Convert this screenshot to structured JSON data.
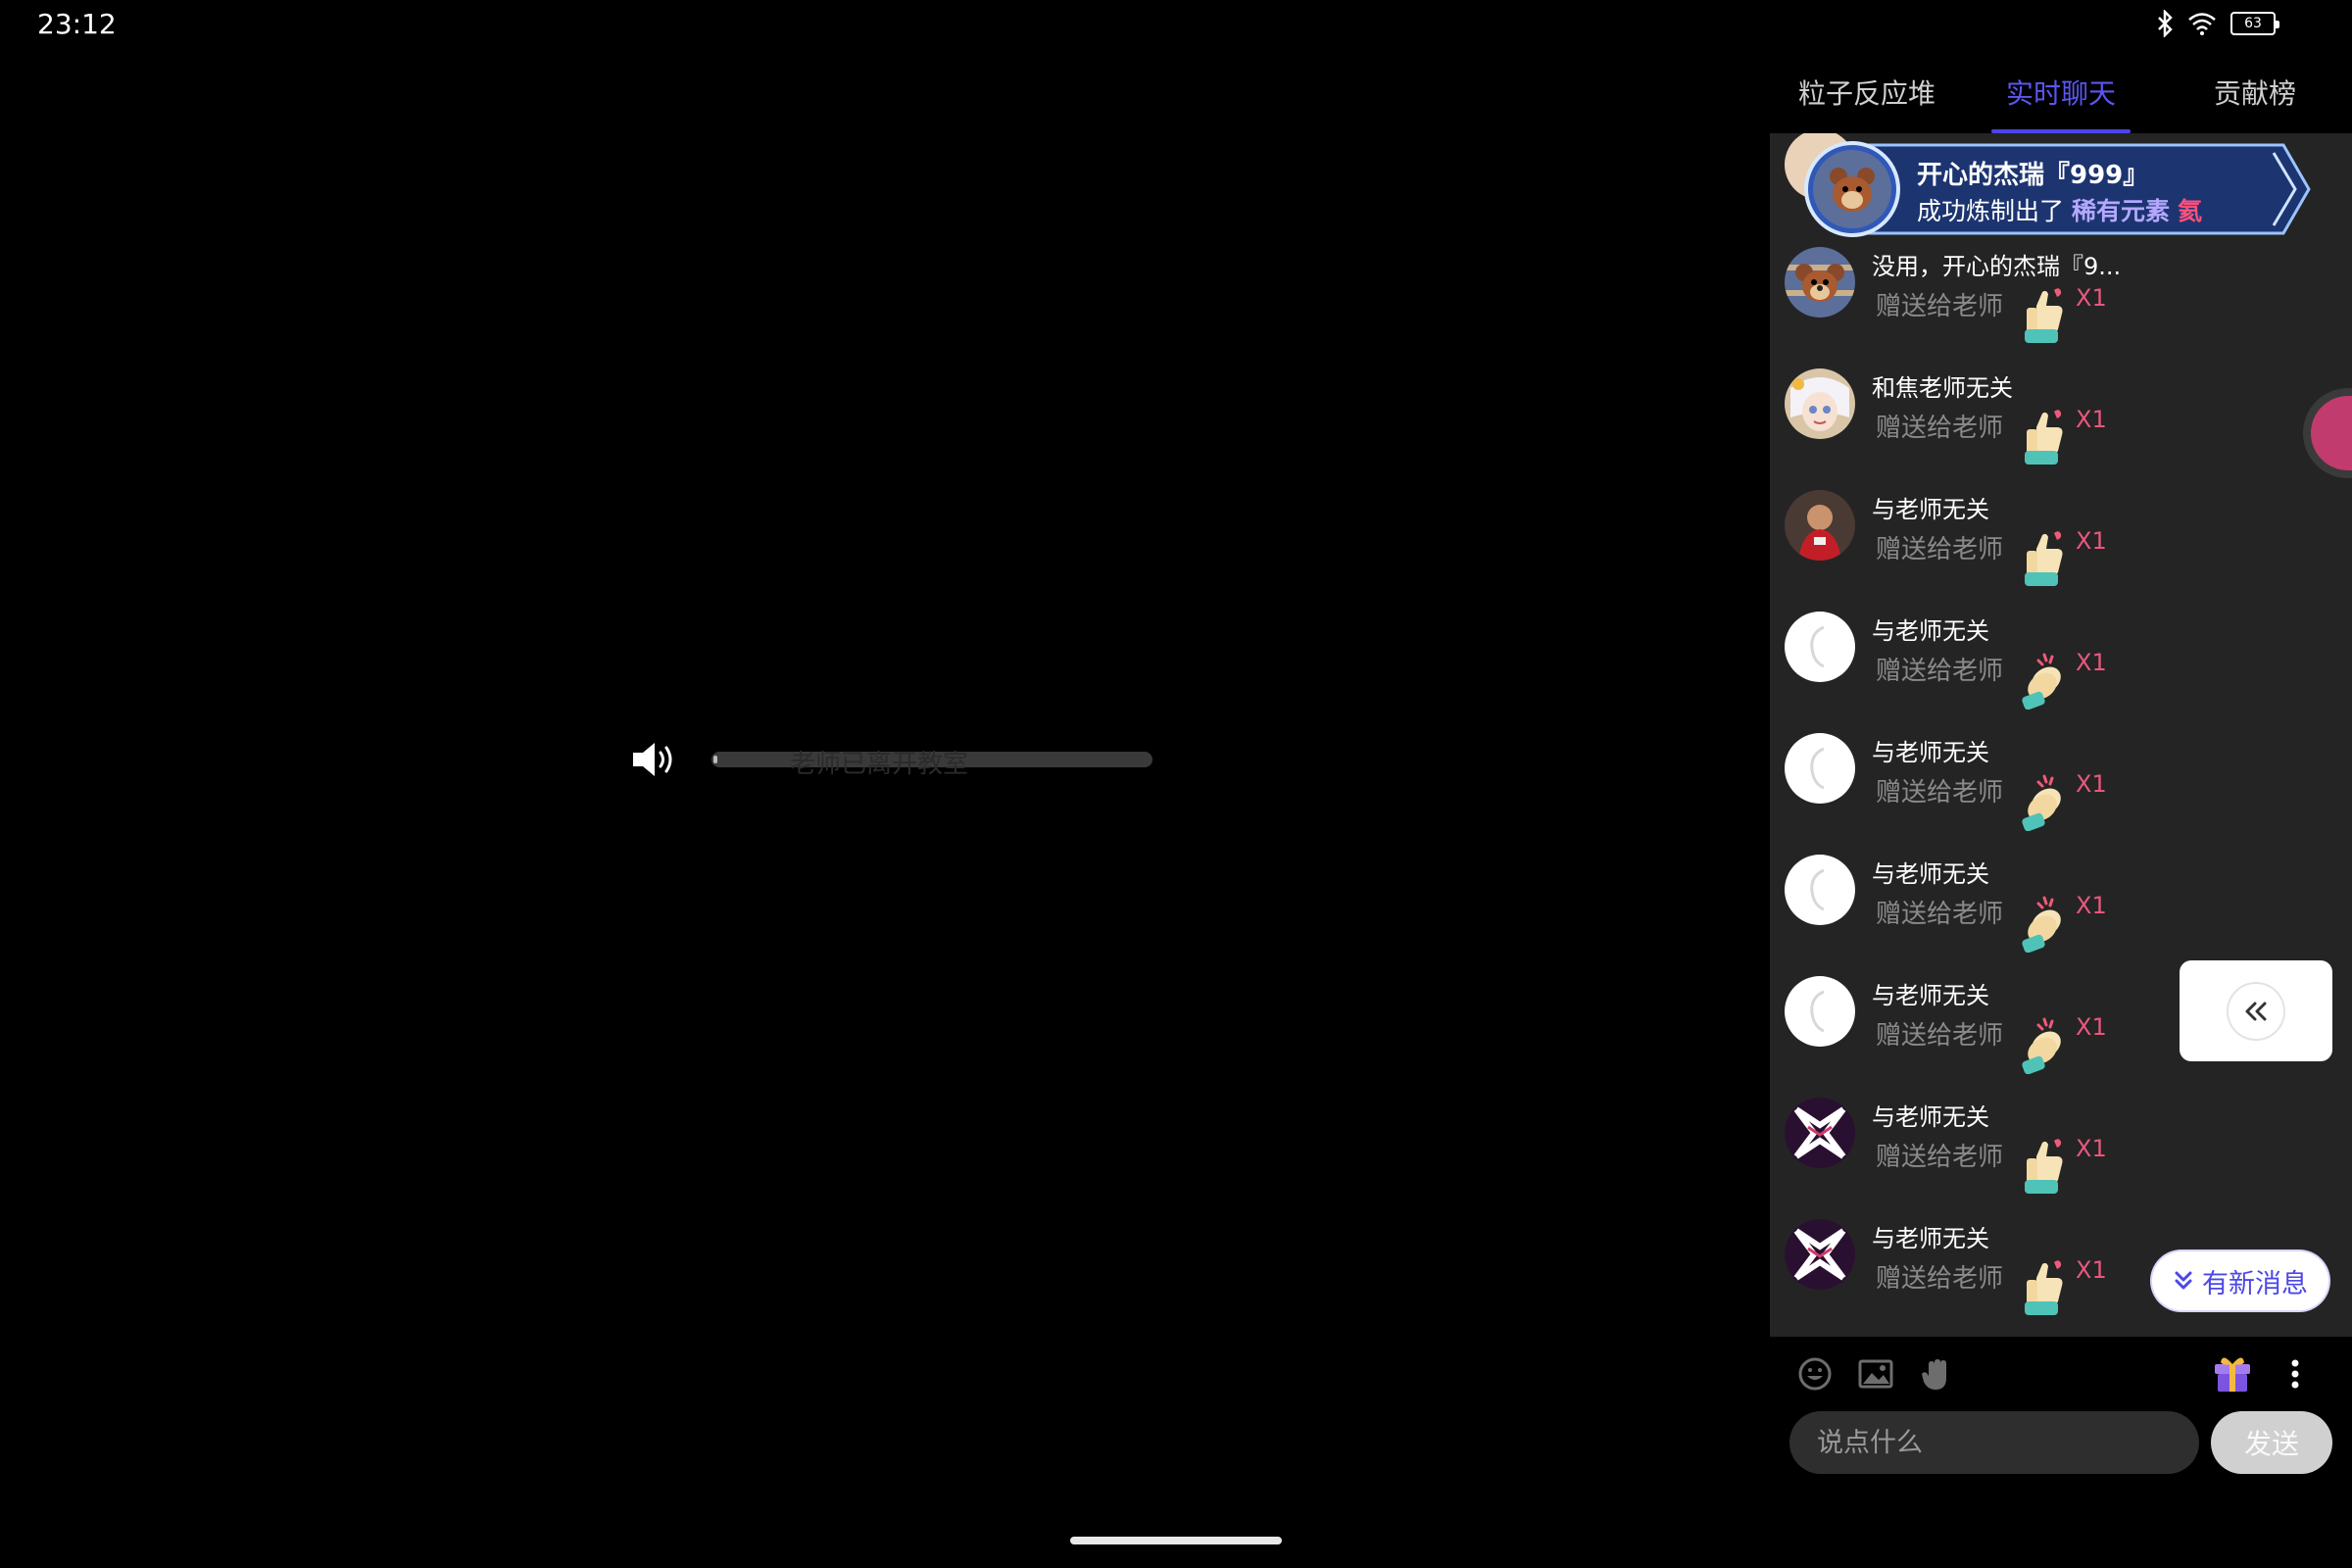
{
  "status_bar": {
    "time": "23:12",
    "battery_level": "63",
    "icons": [
      "bluetooth-icon",
      "wifi-icon",
      "battery-icon"
    ]
  },
  "video": {
    "status_text": "老师已离开教室",
    "icon": "volume-icon"
  },
  "tabs": [
    {
      "label": "粒子反应堆",
      "active": false
    },
    {
      "label": "实时聊天",
      "active": true
    },
    {
      "label": "贡献榜",
      "active": false
    }
  ],
  "banner": {
    "name": "开心的杰瑞『999』",
    "text_prefix": "成功炼制出了",
    "highlight": "稀有元素",
    "element": "氦"
  },
  "messages": [
    {
      "name": "没用，开心的杰瑞『9...",
      "text": "赠送给老师",
      "gift_icon": "thumbs-up-icon",
      "count": "X1",
      "avatar": "jerry"
    },
    {
      "name": "和焦老师无关",
      "text": "赠送给老师",
      "gift_icon": "thumbs-up-icon",
      "count": "X1",
      "avatar": "anime"
    },
    {
      "name": "与老师无关",
      "text": "赠送给老师",
      "gift_icon": "thumbs-up-icon",
      "count": "X1",
      "avatar": "red"
    },
    {
      "name": "与老师无关",
      "text": "赠送给老师",
      "gift_icon": "clapping-hands-icon",
      "count": "X1",
      "avatar": "white"
    },
    {
      "name": "与老师无关",
      "text": "赠送给老师",
      "gift_icon": "clapping-hands-icon",
      "count": "X1",
      "avatar": "white"
    },
    {
      "name": "与老师无关",
      "text": "赠送给老师",
      "gift_icon": "clapping-hands-icon",
      "count": "X1",
      "avatar": "white"
    },
    {
      "name": "与老师无关",
      "text": "赠送给老师",
      "gift_icon": "clapping-hands-icon",
      "count": "X1",
      "avatar": "white"
    },
    {
      "name": "与老师无关",
      "text": "赠送给老师",
      "gift_icon": "thumbs-up-icon",
      "count": "X1",
      "avatar": "x"
    },
    {
      "name": "与老师无关",
      "text": "赠送给老师",
      "gift_icon": "thumbs-up-icon",
      "count": "X1",
      "avatar": "x"
    }
  ],
  "new_messages_label": "有新消息",
  "input": {
    "placeholder": "说点什么",
    "value": "",
    "send_label": "发送"
  },
  "toolbar": {
    "icons": [
      "emoji-icon",
      "image-icon",
      "raise-hand-icon",
      "gift-box-icon",
      "more-icon"
    ]
  },
  "colors": {
    "accent": "#4a45e8",
    "gift_count": "#e8587e",
    "panel_bg": "#242424"
  }
}
